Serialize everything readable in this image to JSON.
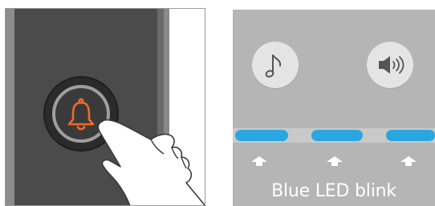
{
  "doorbell_panel": {
    "bell_icon": "bell-icon",
    "hand_icon": "pressing-hand-icon",
    "bell_color": "#f26a2a"
  },
  "led_panel": {
    "buttons": [
      {
        "icon": "music-note-icon"
      },
      {
        "icon": "speaker-volume-icon"
      }
    ],
    "led_color": "#2aa6e0",
    "led_count": 3,
    "caption": "Blue LED blink"
  }
}
